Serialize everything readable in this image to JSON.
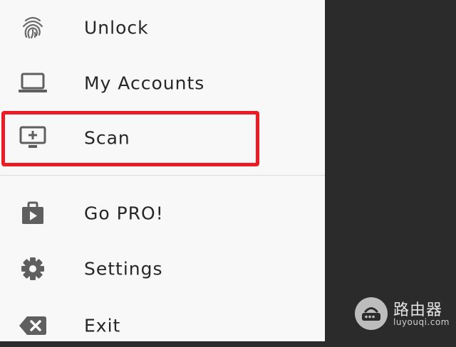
{
  "menu": {
    "items": [
      {
        "label": "Unlock",
        "icon": "fingerprint-icon"
      },
      {
        "label": "My Accounts",
        "icon": "laptop-icon"
      },
      {
        "label": "Scan",
        "icon": "add-to-screen-icon"
      },
      {
        "label": "Go PRO!",
        "icon": "shop-play-icon"
      },
      {
        "label": "Settings",
        "icon": "gear-icon"
      },
      {
        "label": "Exit",
        "icon": "backspace-close-icon"
      }
    ]
  },
  "highlight": {
    "color": "#ec1c24",
    "target": "Scan"
  },
  "colors": {
    "drawer_bg": "#f8f8f8",
    "dark_bg": "#2b2b2b",
    "icon": "#5f5f5f",
    "text": "#262626"
  },
  "watermark": {
    "title": "路由器",
    "subtitle": "luyouqi.com"
  }
}
